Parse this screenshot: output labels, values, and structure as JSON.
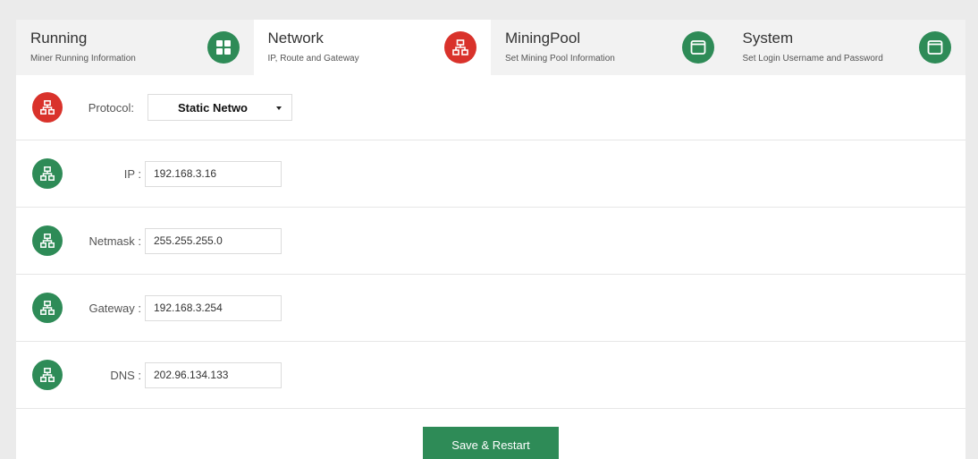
{
  "tabs": [
    {
      "title": "Running",
      "subtitle": "Miner Running Information",
      "icon": "grid-icon",
      "active": false
    },
    {
      "title": "Network",
      "subtitle": "IP, Route and Gateway",
      "icon": "network-icon",
      "active": true
    },
    {
      "title": "MiningPool",
      "subtitle": "Set Mining Pool Information",
      "icon": "window-icon",
      "active": false
    },
    {
      "title": "System",
      "subtitle": "Set Login Username and Password",
      "icon": "window-icon",
      "active": false
    }
  ],
  "form": {
    "protocol": {
      "label": "Protocol:",
      "value": "Static Netwo"
    },
    "ip": {
      "label": "IP :",
      "value": "192.168.3.16"
    },
    "netmask": {
      "label": "Netmask :",
      "value": "255.255.255.0"
    },
    "gateway": {
      "label": "Gateway :",
      "value": "192.168.3.254"
    },
    "dns": {
      "label": "DNS :",
      "value": "202.96.134.133"
    }
  },
  "actions": {
    "save_label": "Save & Restart"
  },
  "colors": {
    "green": "#2e8b57",
    "red": "#d9322b"
  }
}
